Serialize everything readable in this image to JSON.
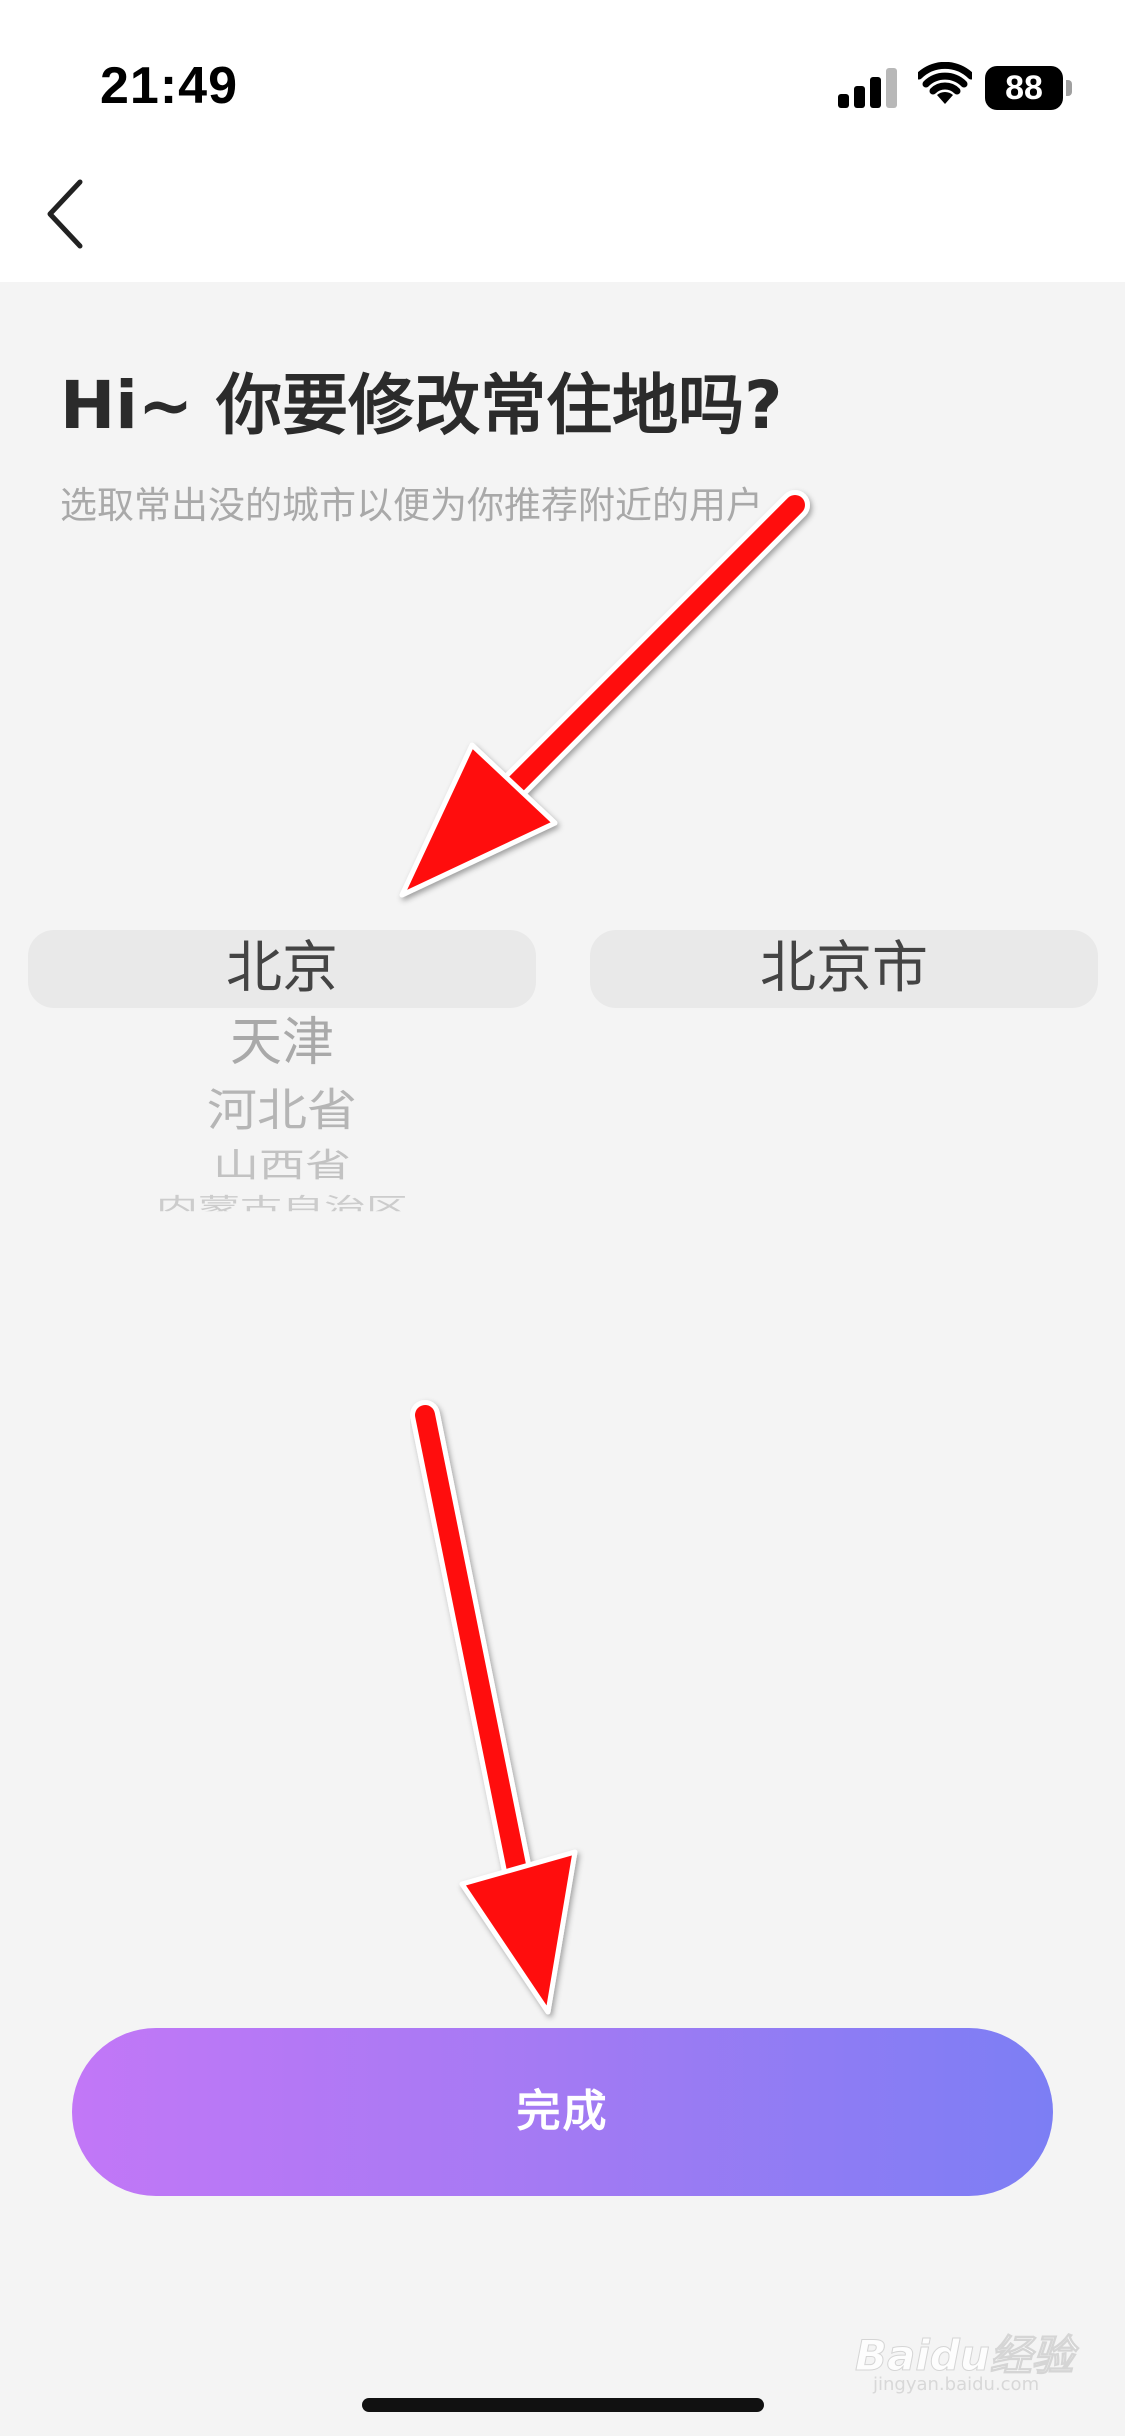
{
  "status_bar": {
    "time": "21:49",
    "battery_level": "88",
    "icons": [
      "cellular-signal-icon",
      "wifi-icon",
      "battery-icon"
    ]
  },
  "nav": {
    "back_icon": "chevron-left-icon"
  },
  "header": {
    "title": "Hi~ 你要修改常住地吗?",
    "subtitle": "选取常出没的城市以便为你推荐附近的用户"
  },
  "picker": {
    "province": {
      "selected": "北京",
      "options": [
        "天津",
        "河北省",
        "山西省",
        "内蒙古自治区"
      ]
    },
    "city": {
      "selected": "北京市"
    }
  },
  "actions": {
    "done_label": "完成"
  },
  "watermark": {
    "brand": "Baidu经验",
    "site": "jingyan.baidu.com"
  },
  "annotations": {
    "arrow_color": "#ff0000",
    "count": 2
  },
  "colors": {
    "button_gradient_start": "#c277f7",
    "button_gradient_end": "#7c7ef4",
    "background": "#f4f4f4",
    "picker_highlight": "#e9e9e9"
  }
}
